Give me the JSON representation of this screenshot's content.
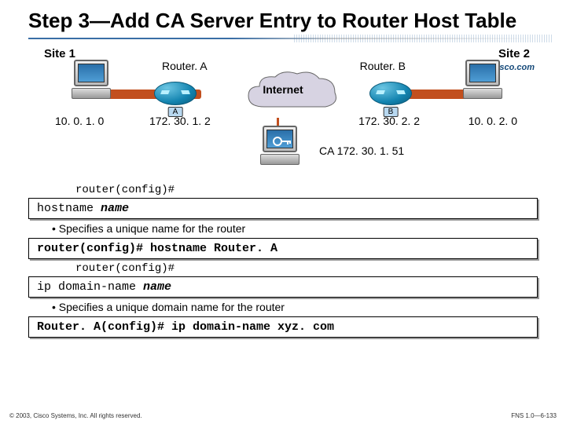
{
  "title": "Step 3—Add CA Server Entry to Router Host Table",
  "logo_text": "Cisco.com",
  "diagram": {
    "site1": "Site 1",
    "site2": "Site 2",
    "routerA_name": "Router. A",
    "routerB_name": "Router. B",
    "routerA_letter": "A",
    "routerB_letter": "B",
    "cloud_label": "Internet",
    "pc1_ip": "10. 0. 1. 0",
    "routerA_ip": "172. 30. 1. 2",
    "routerB_ip": "172. 30. 2. 2",
    "pc2_ip": "10. 0. 2. 0",
    "ca_label": "CA 172. 30. 1. 51"
  },
  "lines": {
    "prompt1": "router(config)#",
    "cmd1_pre": "hostname ",
    "cmd1_arg": "name",
    "bullet1": "Specifies a unique name for the router",
    "cmd2": "router(config)# hostname Router. A",
    "prompt2": "router(config)#",
    "cmd3_pre": "ip domain-name ",
    "cmd3_arg": "name",
    "bullet2": "Specifies a unique domain name for the router",
    "cmd4": "Router. A(config)# ip domain-name xyz. com"
  },
  "footer": {
    "left": "© 2003, Cisco Systems, Inc. All rights reserved.",
    "right": "FNS 1.0—6-133"
  }
}
